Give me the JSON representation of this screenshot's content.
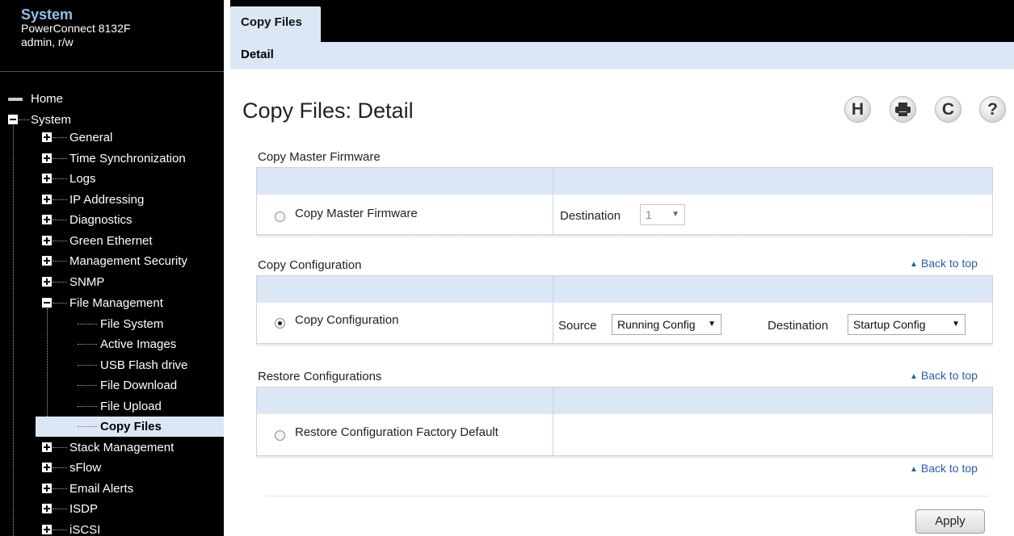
{
  "sidebar": {
    "title": "System",
    "model": "PowerConnect 8132F",
    "user": "admin, r/w",
    "tree": {
      "home": "Home",
      "system": "System",
      "general": "General",
      "time_sync": "Time Synchronization",
      "logs": "Logs",
      "ip_addressing": "IP Addressing",
      "diagnostics": "Diagnostics",
      "green_ethernet": "Green Ethernet",
      "management_security": "Management Security",
      "snmp": "SNMP",
      "file_management": "File Management",
      "file_system": "File System",
      "active_images": "Active Images",
      "usb_flash_drive": "USB Flash drive",
      "file_download": "File Download",
      "file_upload": "File Upload",
      "copy_files": "Copy Files",
      "stack_management": "Stack Management",
      "sflow": "sFlow",
      "email_alerts": "Email Alerts",
      "isdp": "ISDP",
      "iscsi": "iSCSI"
    }
  },
  "tabs": {
    "active": "Copy Files",
    "sub": "Detail"
  },
  "page": {
    "title": "Copy Files: Detail"
  },
  "toolbar": {
    "save_icon": "H",
    "print_icon": "print-icon",
    "refresh_icon": "C",
    "help_icon": "?"
  },
  "sections": {
    "firmware": {
      "title": "Copy Master Firmware",
      "option_label": "Copy Master Firmware",
      "selected": false,
      "destination_label": "Destination",
      "destination_value": "1"
    },
    "configuration": {
      "title": "Copy Configuration",
      "back_to_top": "Back to top",
      "option_label": "Copy Configuration",
      "selected": true,
      "source_label": "Source",
      "source_value": "Running Config",
      "destination_label": "Destination",
      "destination_value": "Startup Config"
    },
    "restore": {
      "title": "Restore Configurations",
      "back_to_top": "Back to top",
      "option_label": "Restore Configuration Factory Default",
      "selected": false,
      "bottom_back_to_top": "Back to top"
    }
  },
  "actions": {
    "apply": "Apply"
  },
  "colors": {
    "accent_light": "#dce7f5",
    "sidebar_bg": "#000000",
    "title_blue": "#8fc1ea",
    "link_blue": "#2a5cb0"
  }
}
